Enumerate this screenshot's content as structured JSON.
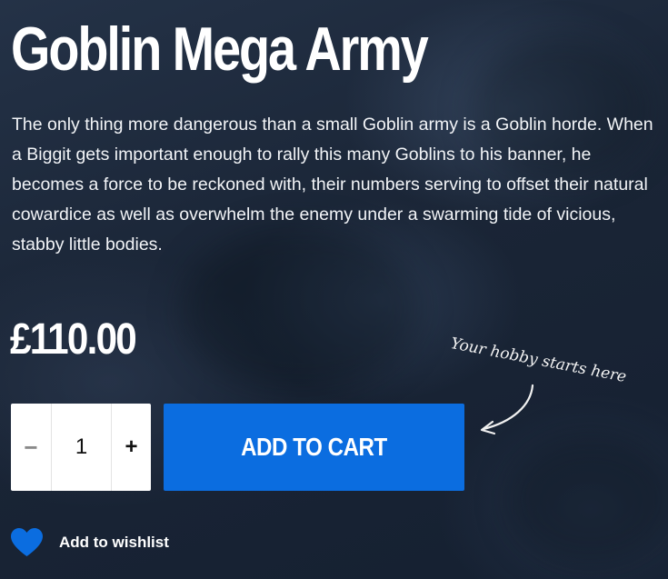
{
  "product": {
    "title": "Goblin Mega Army",
    "description": "The only thing more dangerous than a small Goblin army is a Goblin horde. When a Biggit gets important enough to rally this many Goblins to his banner, he becomes a force to be reckoned with, their numbers serving to offset their natural cowardice as well as overwhelm the enemy under a swarming tide of vicious, stabby little bodies.",
    "price": "£110.00"
  },
  "note": {
    "text": "Your hobby starts here",
    "arrow_icon": "curved-arrow-icon"
  },
  "quantity": {
    "decrement_label": "−",
    "value": "1",
    "increment_label": "+"
  },
  "cart": {
    "label": "ADD TO CART",
    "color": "#0b6de0"
  },
  "wishlist": {
    "label": "Add to wishlist",
    "icon": "heart-icon",
    "icon_color": "#0b6de0"
  },
  "colors": {
    "background": "#1b2738",
    "text": "#ffffff"
  }
}
